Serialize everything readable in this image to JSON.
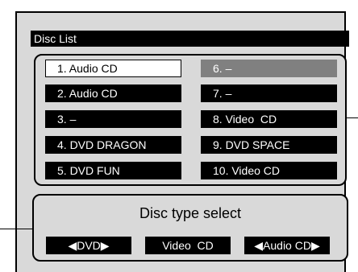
{
  "title": "Disc List",
  "list": {
    "left": [
      {
        "label": "1. Audio CD",
        "state": "selected"
      },
      {
        "label": "2. Audio CD",
        "state": "normal"
      },
      {
        "label": "3. –",
        "state": "normal"
      },
      {
        "label": "4. DVD DRAGON",
        "state": "normal"
      },
      {
        "label": "5. DVD FUN",
        "state": "normal"
      }
    ],
    "right": [
      {
        "label": "6. –",
        "state": "dim"
      },
      {
        "label": "7. –",
        "state": "normal"
      },
      {
        "label": "8. Video  CD",
        "state": "normal"
      },
      {
        "label": "9. DVD SPACE",
        "state": "normal"
      },
      {
        "label": "10. Video CD",
        "state": "normal"
      }
    ]
  },
  "disc_type": {
    "heading": "Disc type select",
    "options": [
      "◀DVD▶",
      "Video  CD",
      "◀Audio CD▶"
    ]
  }
}
